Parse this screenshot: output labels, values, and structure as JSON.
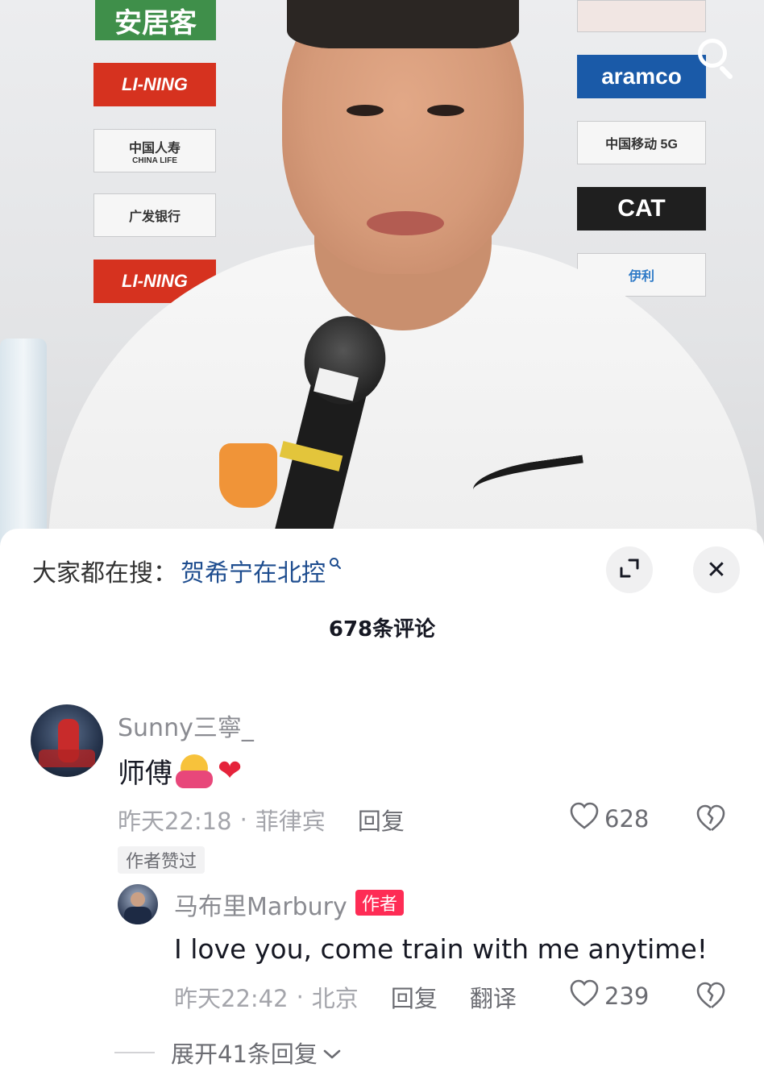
{
  "video": {
    "sponsors": [
      "安居客",
      "LI-NING",
      "中国人寿",
      "CHINA LIFE",
      "广发银行",
      "aramco",
      "中国移动 5G",
      "CAT",
      "伊利"
    ],
    "search_icon": "search-icon"
  },
  "sheet": {
    "hot_search_prefix": "大家都在搜：",
    "hot_search_term": "贺希宁在北控",
    "hot_search_icon": "magnifier-small-icon",
    "expand_icon": "expand-corner-icon",
    "close_icon": "close-icon",
    "close_glyph": "✕",
    "comment_count": "678条评论"
  },
  "comments": [
    {
      "username": "Sunny三寧_",
      "text": "师傅",
      "emojis": [
        "hugging-emoji",
        "red-heart-emoji"
      ],
      "heart_glyph": "❤",
      "time": "昨天22:18",
      "location": "菲律宾",
      "reply_label": "回复",
      "likes": "628",
      "liked_badge": "作者赞过",
      "replies": [
        {
          "username": "马布里Marbury",
          "badge": "作者",
          "text": "I love you, come train with me anytime!",
          "time": "昨天22:42",
          "location": "北京",
          "reply_label": "回复",
          "translate_label": "翻译",
          "likes": "239"
        }
      ],
      "expand_label": "展开41条回复"
    }
  ],
  "colors": {
    "accent_red": "#fe2c55",
    "link_blue": "#1e4d8f",
    "muted_text": "#a4a5ab",
    "heart_red": "#e5233b"
  }
}
